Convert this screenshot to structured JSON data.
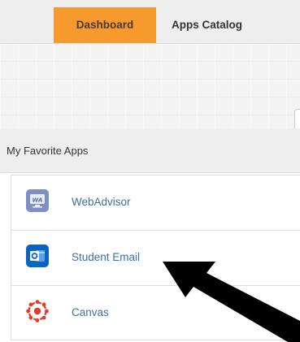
{
  "nav": {
    "tabs": [
      {
        "label": "Dashboard",
        "active": true
      },
      {
        "label": "Apps Catalog",
        "active": false
      }
    ],
    "active_color": "#f79a2e"
  },
  "favorites": {
    "title": "My Favorite Apps",
    "apps": [
      {
        "label": "WebAdvisor",
        "icon": "webadvisor-icon"
      },
      {
        "label": "Student Email",
        "icon": "outlook-icon"
      },
      {
        "label": "Canvas",
        "icon": "canvas-icon"
      }
    ]
  },
  "link_color": "#3f6ea8",
  "annotation_arrow_color": "#000000"
}
